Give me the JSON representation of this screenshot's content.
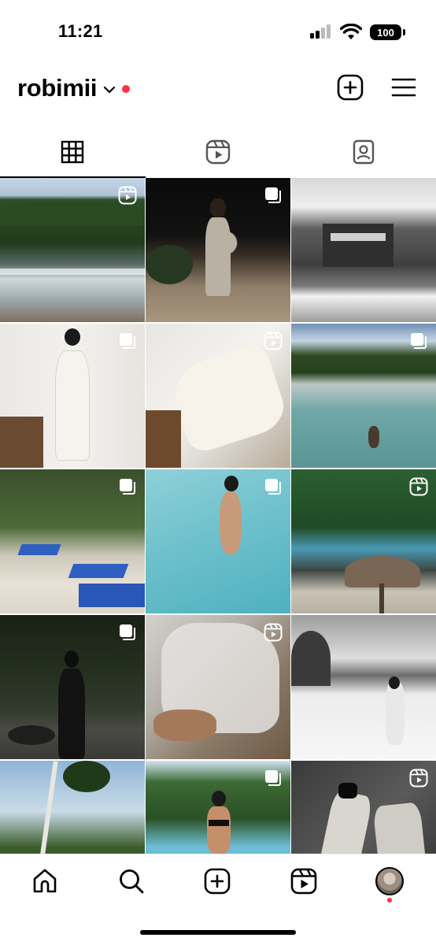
{
  "status_bar": {
    "time": "11:21",
    "battery": "100"
  },
  "header": {
    "username": "robimii",
    "icons": [
      "chevron-down-icon",
      "notification-dot",
      "new-post-icon",
      "menu-icon"
    ],
    "accent_color": "#ff3040"
  },
  "tabs": [
    {
      "name": "posts-grid",
      "icon": "grid-icon",
      "active": true
    },
    {
      "name": "reels",
      "icon": "reels-icon",
      "active": false
    },
    {
      "name": "tagged",
      "icon": "tagged-icon",
      "active": false
    }
  ],
  "grid": {
    "tiles": [
      {
        "id": "t1",
        "badge": "reel-icon"
      },
      {
        "id": "t2",
        "badge": "carousel-icon"
      },
      {
        "id": "t3",
        "badge": ""
      },
      {
        "id": "t4",
        "badge": "carousel-icon"
      },
      {
        "id": "t5",
        "badge": "reel-icon"
      },
      {
        "id": "t6",
        "badge": "carousel-icon"
      },
      {
        "id": "t7",
        "badge": "carousel-icon"
      },
      {
        "id": "t8",
        "badge": "carousel-icon"
      },
      {
        "id": "t9",
        "badge": "reel-icon"
      },
      {
        "id": "t10",
        "badge": "carousel-icon"
      },
      {
        "id": "t11",
        "badge": "reel-icon"
      },
      {
        "id": "t12",
        "badge": ""
      },
      {
        "id": "t13",
        "badge": ""
      },
      {
        "id": "t14",
        "badge": "carousel-icon"
      },
      {
        "id": "t15",
        "badge": "reel-icon"
      }
    ]
  },
  "bottom_nav": {
    "items": [
      {
        "name": "home",
        "icon": "home-icon"
      },
      {
        "name": "search",
        "icon": "search-icon"
      },
      {
        "name": "create",
        "icon": "create-icon"
      },
      {
        "name": "reels",
        "icon": "reels-icon"
      },
      {
        "name": "profile",
        "icon": "avatar"
      }
    ]
  }
}
